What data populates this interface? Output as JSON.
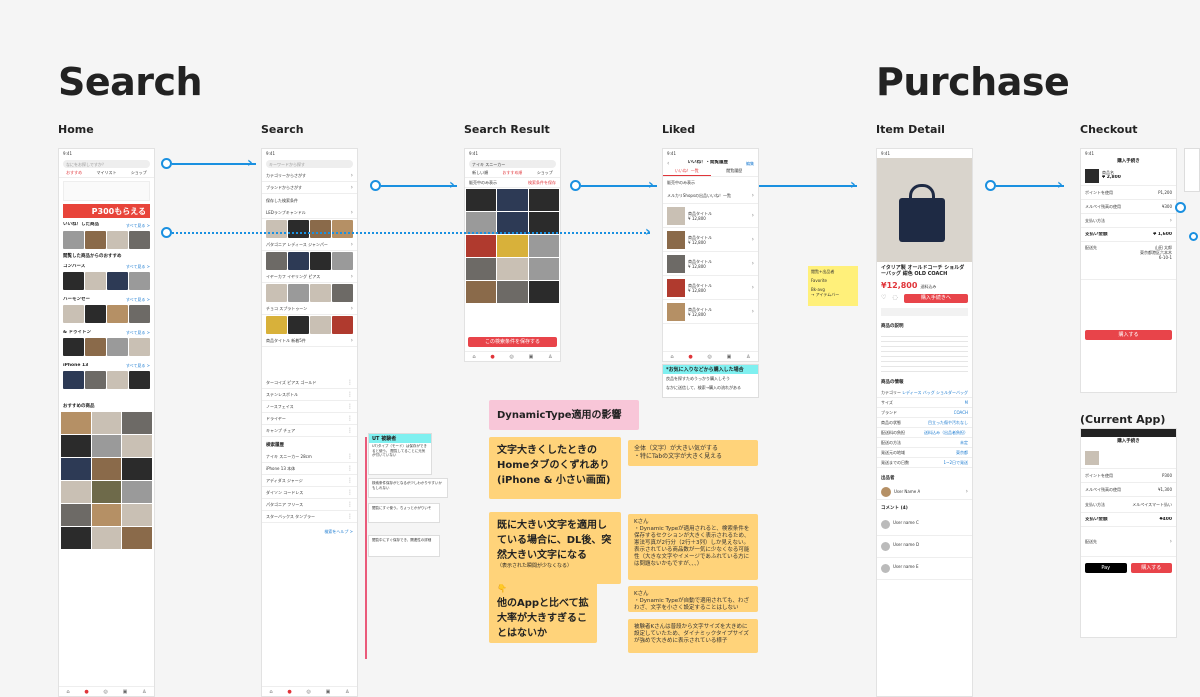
{
  "sections": {
    "search": "Search",
    "purchase": "Purchase"
  },
  "frames": {
    "home": "Home",
    "search": "Search",
    "search_result": "Search Result",
    "liked": "Liked",
    "item_detail": "Item Detail",
    "checkout": "Checkout",
    "current_app": "(Current App)"
  },
  "home": {
    "time": "9:41",
    "search_placeholder": "なにをお探しですか？",
    "tabs": [
      "おすすめ",
      "マイリスト",
      "ショップ"
    ],
    "banner": "P300もらえる",
    "liked_title": "いいね！した商品",
    "see_all": "すべて見る >",
    "viewed_title": "閲覧した商品からのおすすめ",
    "brand1": "コンバース",
    "brand2": "ハーモンセー",
    "brand3": "& ドゥイトン",
    "brand4": "iPhone 13",
    "rec_title": "おすすめの商品"
  },
  "search": {
    "time": "9:41",
    "placeholder": "キーワードから探す",
    "rows": [
      "カテゴリーからさがす",
      "ブランドからさがす",
      "保存した検索条件"
    ],
    "saved1": "LEDランプキャンドル",
    "saved2": "パタゴニア レディース ジャンパー",
    "saved3": "イヤーカフ イヤリング ピアス",
    "saved4": "チョコ スプラトゥーン",
    "saved5": "商品タイトル 新着5件",
    "history_title": "検索履歴",
    "history": [
      "ナイキ スニーカー 28cm",
      "iPhone 13 本体",
      "アディダス ジャージ",
      "ダイソン コードレス",
      "パタゴニア フリース"
    ],
    "keywords": [
      "ターコイズ ピアス ゴールド",
      "ステンレスボトル",
      "ノースフェイス",
      "ドライヤー",
      "キャンプ チェア",
      "スターバックス タンブラー"
    ],
    "help": "検索をヘルプ >"
  },
  "result": {
    "time": "9:41",
    "query": "ナイキ スニーカー",
    "tabs": [
      "新しい順",
      "おすすめ順",
      "ショップ"
    ],
    "filter": "販売中のみ表示",
    "save_condition": "検索条件を保存",
    "cta": "この検索条件を保存する"
  },
  "liked": {
    "time": "9:41",
    "title": "いいね！・閲覧履歴",
    "edit": "編集",
    "tabs": [
      "いいね！一覧",
      "閲覧履歴"
    ],
    "filter": "販売中のみ表示",
    "notice": "メルカリShopsの出品いいね！一覧",
    "item_title": "商品タイトル",
    "price": "¥ 12,800",
    "callout_title": "*お気に入りなどから購入した場合",
    "callout_1": "良品を探すためうっかり購入しそう",
    "callout_2": "なかに送信して、検索→購入の流れがある"
  },
  "item": {
    "time": "9:41",
    "title": "イタリア製 オールドコーチ ショルダーバッグ 紺色 OLD COACH",
    "price": "¥12,800",
    "shipping": "送料込み",
    "buy": "購入手続きへ",
    "desc_title": "商品の説明",
    "info_title": "商品の情報",
    "info": [
      [
        "カテゴリー",
        "レディース バッグ ショルダーバッグ"
      ],
      [
        "サイズ",
        "M"
      ],
      [
        "ブランド",
        "COACH"
      ],
      [
        "商品の状態",
        "目立った傷や汚れなし"
      ],
      [
        "配送料の負担",
        "送料込み（出品者負担）"
      ],
      [
        "配送の方法",
        "未定"
      ],
      [
        "発送元の地域",
        "東京都"
      ],
      [
        "発送までの日数",
        "1~2日で発送"
      ]
    ],
    "seller_title": "出品者",
    "seller_name": "User Name A",
    "comments_title": "コメント (4)",
    "comment_users": [
      "User name C",
      "User name D",
      "User name E"
    ],
    "sticky_title": "閲覧+出品者",
    "sticky_body": "Favorite",
    "sticky_link": "Bk-avg",
    "sticky_extra": "→ アイテムバー"
  },
  "checkout": {
    "time": "9:41",
    "title": "購入手続き",
    "product": "商品名",
    "price": "¥ 2,800",
    "points_label": "ポイントを使用",
    "points_value": "P1,200",
    "wallet": "メルペイ残高の使用",
    "wallet_value": "¥300",
    "method": "支払い方法",
    "total_label": "支払い金額",
    "total": "¥ 1,600",
    "address_label": "配送先",
    "address_lines": [
      "山田 太郎",
      "東京都港区六本木",
      "6-10-1"
    ],
    "buy": "購入する"
  },
  "current": {
    "title": "購入手続き",
    "points_value": "P300",
    "wallet_value": "¥1,300",
    "method_label": "支払い方法",
    "method_value": "メルペイスマート払い",
    "total_label": "支払い金額",
    "total": "¥400",
    "address_label": "配送先",
    "pay": "Pay",
    "buy": "購入する"
  },
  "notes": {
    "dynamic_type": "DynamicType適用の影響",
    "n1": "文字大きくしたときのHomeタブのくずれあり (iPhone & 小さい画面)",
    "n1_side": "全体（文字）が大きい気がする\n・特にTabの文字が大きく見える",
    "n2": "既に大きい文字を適用している場合に、DL後、突然大きい文字になる",
    "n2_small": "（表示された瞬間が少なくなる）",
    "n2_side": "Kさん\n・Dynamic Typeが適用されると、検索条件を保存するセクションが大きく表示されるため、憲法写真が2行分（2行＋3列）しか見えない。表示されている商品数が一気に少なくなる可能性（大きな文字やイメージであふれている方には問題ないかもですが、、、）",
    "n3": "他のAppと比べて拡大率が大きすぎることはないか",
    "n3_side": "Kさん\n・Dynamic Typeが自動で適用されても、わざわざ、文字を小さく設定することはしない",
    "n4_side": "被験者Kさんは普段から文字サイズを大きめに設定していたため、ダイナミックタイプサイズが強めで大きめに表示されている様子",
    "ut_title": "UT 被験者",
    "ut_body": "UT/タイプ（モード）は保存ができると使う。\n閲覧してることに元気が付いていない"
  },
  "search_notes": {
    "n1": "検索条件保存がとなるが少しわかりやすいかもしれない",
    "n2": "閲覧にすぐ使う。ちょっとかがりいそ",
    "n3": "閲覧中にすぐ保存でき、関連性の詳細"
  }
}
